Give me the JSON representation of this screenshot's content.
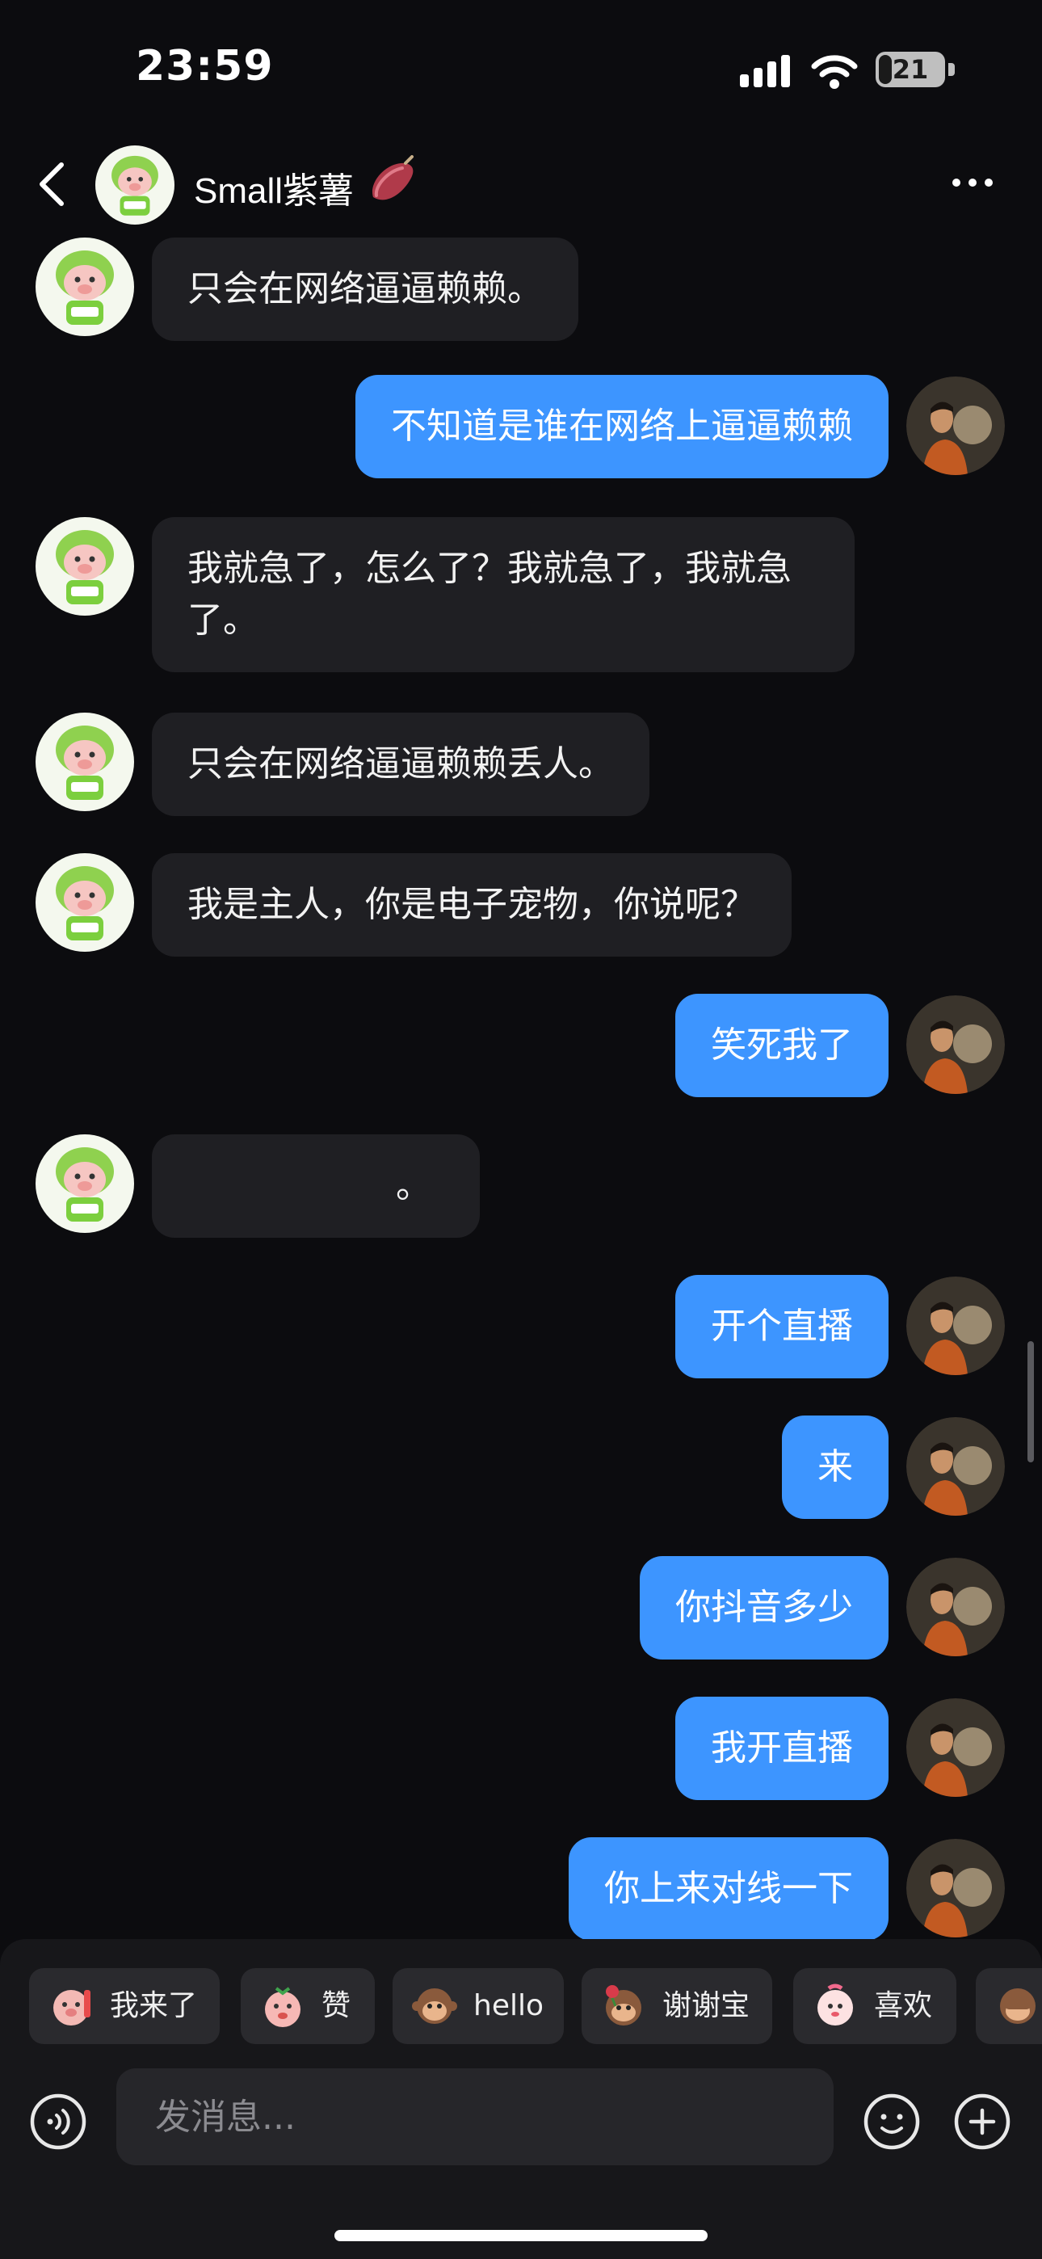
{
  "status_bar": {
    "time": "23:59",
    "battery": "21",
    "battery_level": 0.21
  },
  "header": {
    "contact_name": "Small紫薯"
  },
  "messages": [
    {
      "side": "left",
      "text": "只会在网络逼逼赖赖。"
    },
    {
      "side": "right",
      "text": "不知道是谁在网络上逼逼赖赖"
    },
    {
      "side": "left",
      "text": "我就急了，怎么了？我就急了，我就急了。"
    },
    {
      "side": "left",
      "text": "只会在网络逼逼赖赖丢人。"
    },
    {
      "side": "left",
      "text": "我是主人，你是电子宠物，你说呢？"
    },
    {
      "side": "right",
      "text": "笑死我了"
    },
    {
      "side": "left",
      "text": "。"
    },
    {
      "side": "right",
      "text": "开个直播"
    },
    {
      "side": "right",
      "text": "来"
    },
    {
      "side": "right",
      "text": "你抖音多少"
    },
    {
      "side": "right",
      "text": "我开直播"
    },
    {
      "side": "right",
      "text": "你上来对线一下"
    }
  ],
  "quick_replies": [
    {
      "label": "我来了",
      "icon": "pig-emoji-icon"
    },
    {
      "label": "赞",
      "icon": "thumbs-up-emoji-icon"
    },
    {
      "label": "hello",
      "icon": "monkey-emoji-icon"
    },
    {
      "label": "谢谢宝",
      "icon": "monkey-rose-emoji-icon"
    },
    {
      "label": "喜欢",
      "icon": "heart-face-emoji-icon"
    },
    {
      "label": "",
      "icon": "monkey-emoji-icon"
    }
  ],
  "composer": {
    "placeholder": "发消息..."
  },
  "colors": {
    "background": "#0c0c0f",
    "bubble_left": "#1f1f23",
    "bubble_right": "#3d95ff"
  }
}
